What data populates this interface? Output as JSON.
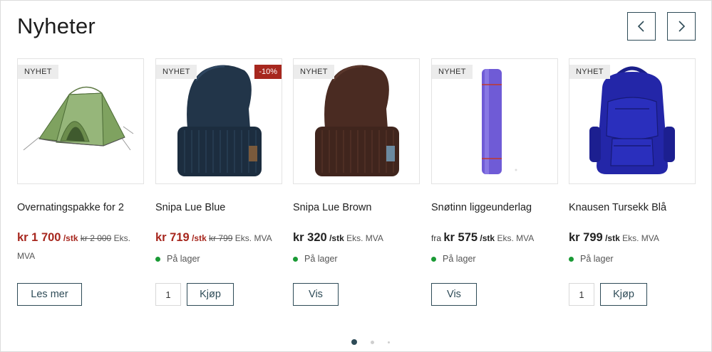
{
  "section": {
    "title": "Nyheter",
    "prev_label": "‹",
    "next_label": "›"
  },
  "colors": {
    "accent": "#2e4b57",
    "sale": "#a7271e",
    "in_stock": "#1a9a35"
  },
  "products": [
    {
      "badge": "NYHET",
      "image": "tent-icon",
      "name": "Overnatingspakke for 2",
      "price": "kr 1 700",
      "unit": "/stk",
      "old_price": "kr 2 000",
      "vat": "Eks. MVA",
      "button": "Les mer"
    },
    {
      "badge": "NYHET",
      "discount": "-10%",
      "image": "beanie-blue-icon",
      "name": "Snipa Lue Blue",
      "price": "kr 719",
      "unit": "/stk",
      "old_price": "kr 799",
      "vat": "Eks. MVA",
      "stock": "På lager",
      "qty": "1",
      "button": "Kjøp"
    },
    {
      "badge": "NYHET",
      "image": "beanie-brown-icon",
      "name": "Snipa Lue Brown",
      "price": "kr 320",
      "unit": "/stk",
      "vat": "Eks. MVA",
      "stock": "På lager",
      "button": "Vis"
    },
    {
      "badge": "NYHET",
      "image": "sleeping-mat-icon",
      "name": "Snøtinn liggeunderlag",
      "from": "fra",
      "price": "kr 575",
      "unit": "/stk",
      "vat": "Eks. MVA",
      "stock": "På lager",
      "button": "Vis"
    },
    {
      "badge": "NYHET",
      "image": "backpack-icon",
      "name": "Knausen Tursekk Blå",
      "price": "kr 799",
      "unit": "/stk",
      "vat": "Eks. MVA",
      "stock": "På lager",
      "qty": "1",
      "button": "Kjøp"
    }
  ],
  "pagination": {
    "pages": 3,
    "active": 1
  }
}
